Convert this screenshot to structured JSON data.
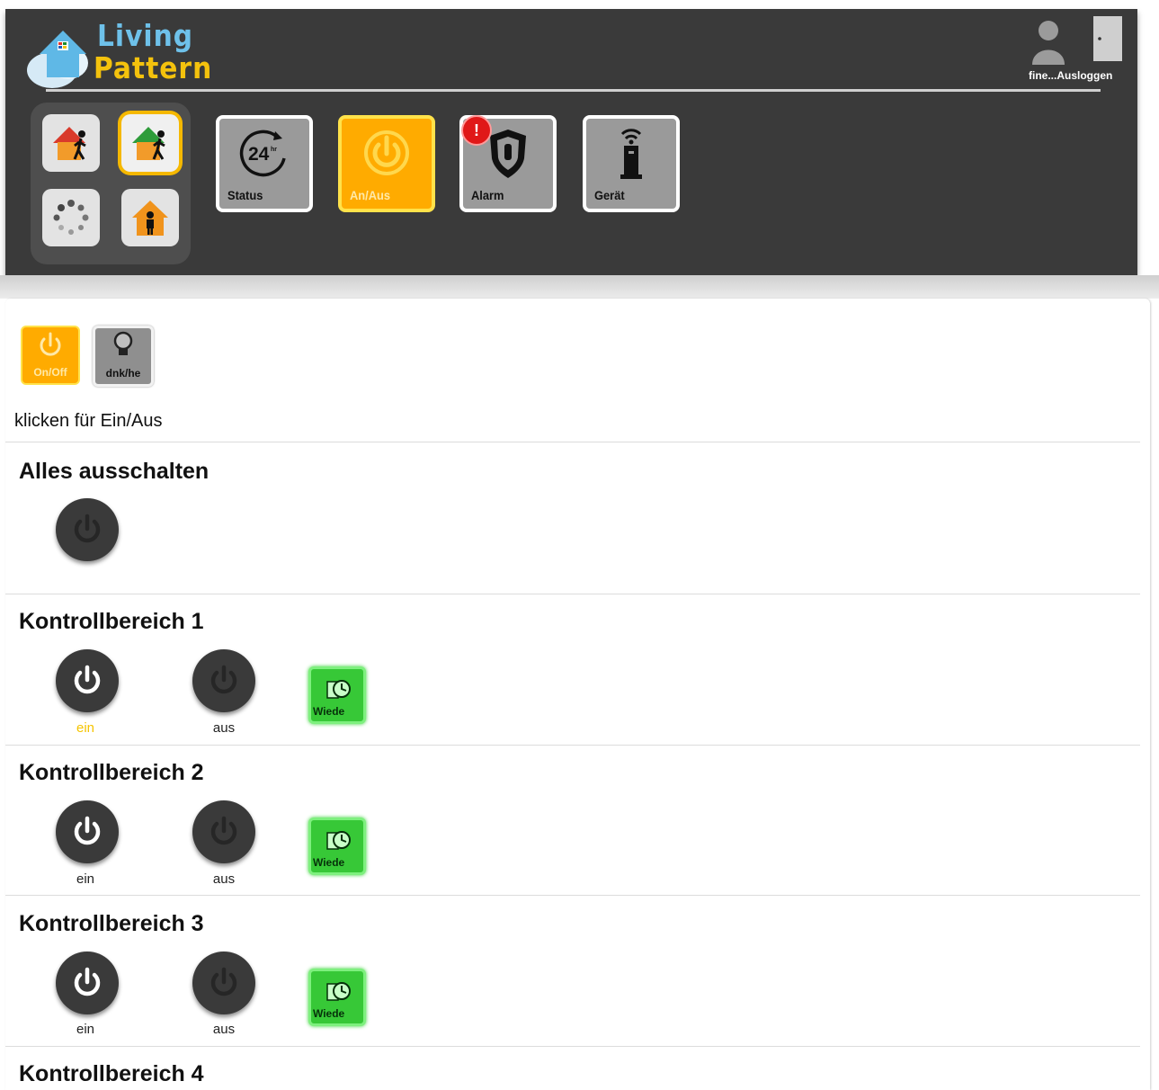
{
  "header": {
    "brand_line1": "Living",
    "brand_line2": "Pattern",
    "user_text": "fine...Ausloggen",
    "nav": [
      {
        "label": "Status",
        "icon": "24hr-icon"
      },
      {
        "label": "An/Aus",
        "icon": "power-icon"
      },
      {
        "label": "Alarm",
        "icon": "shield-icon"
      },
      {
        "label": "Gerät",
        "icon": "gateway-icon"
      }
    ],
    "alarm_badge": "!"
  },
  "content": {
    "tabs": [
      {
        "label": "On/Off"
      },
      {
        "label": "dnk/he"
      }
    ],
    "hint": "klicken für Ein/Aus",
    "all_off_title": "Alles ausschalten",
    "sections": [
      {
        "title": "Kontrollbereich 1",
        "on_label": "ein",
        "off_label": "aus",
        "schedule_label": "Wiede"
      },
      {
        "title": "Kontrollbereich 2",
        "on_label": "ein",
        "off_label": "aus",
        "schedule_label": "Wiede"
      },
      {
        "title": "Kontrollbereich 3",
        "on_label": "ein",
        "off_label": "aus",
        "schedule_label": "Wiede"
      },
      {
        "title": "Kontrollbereich 4"
      }
    ]
  },
  "colors": {
    "accent": "#ffab00",
    "header_bg": "#3a3a3a",
    "schedule_green": "#37c837"
  }
}
